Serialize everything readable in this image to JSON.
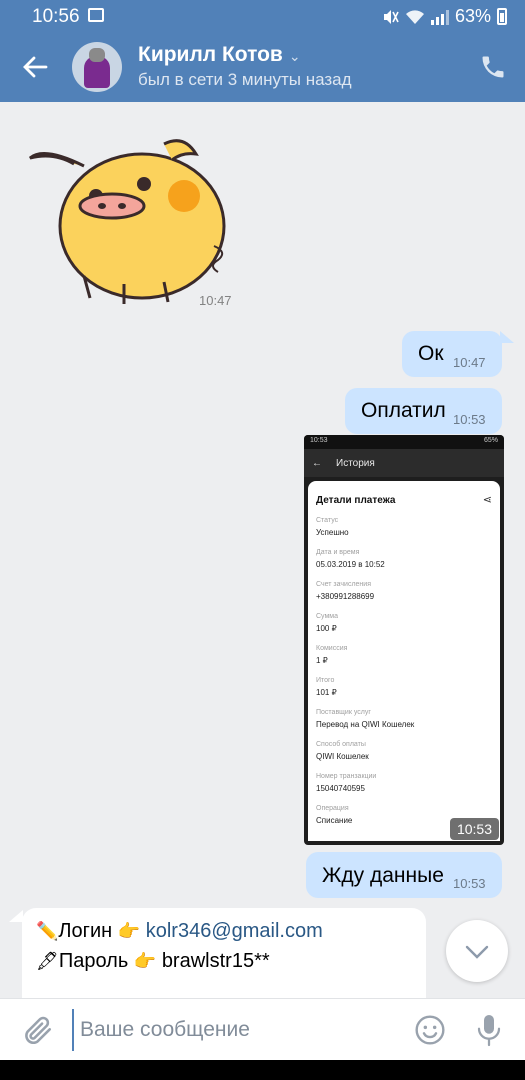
{
  "status_bar": {
    "time": "10:56",
    "battery": "63%"
  },
  "header": {
    "name": "Кирилл Котов",
    "status": "был в сети 3 минуты назад"
  },
  "messages": [
    {
      "type": "sticker",
      "time": "10:47"
    },
    {
      "type": "out",
      "text": "Ок",
      "time": "10:47"
    },
    {
      "type": "out",
      "text": "Оплатил",
      "time": "10:53"
    },
    {
      "type": "image",
      "time": "10:53"
    },
    {
      "type": "out",
      "text": "Жду данные",
      "time": "10:53"
    }
  ],
  "screenshot": {
    "status_time": "10:53",
    "status_batt": "65%",
    "toolbar_title": "История",
    "card_title": "Детали платежа",
    "fields": [
      {
        "label": "Статус",
        "value": "Успешно"
      },
      {
        "label": "Дата и время",
        "value": "05.03.2019 в 10:52"
      },
      {
        "label": "Счет зачисления",
        "value": "+380991288699"
      },
      {
        "label": "Сумма",
        "value": "100 ₽"
      },
      {
        "label": "Комиссия",
        "value": "1 ₽"
      },
      {
        "label": "Итого",
        "value": "101 ₽"
      },
      {
        "label": "Поставщик услуг",
        "value": "Перевод на QIWI Кошелек"
      },
      {
        "label": "Способ оплаты",
        "value": "QIWI Кошелек"
      },
      {
        "label": "Номер транзакции",
        "value": "15040740595"
      },
      {
        "label": "Операция",
        "value": "Списание"
      }
    ]
  },
  "incoming": {
    "login_label": "Логин",
    "login_value": "kolr346@gmail.com",
    "password_label": "Пароль",
    "password_value": "brawlstr15**",
    "emoji_pencil": "✏️",
    "emoji_pen": "🖋",
    "emoji_point": "👉"
  },
  "composer": {
    "placeholder": "Ваше сообщение"
  },
  "colors": {
    "header": "#5181b8",
    "out_bubble": "#cce4ff",
    "background": "#edeef0",
    "link": "#2a5885"
  }
}
